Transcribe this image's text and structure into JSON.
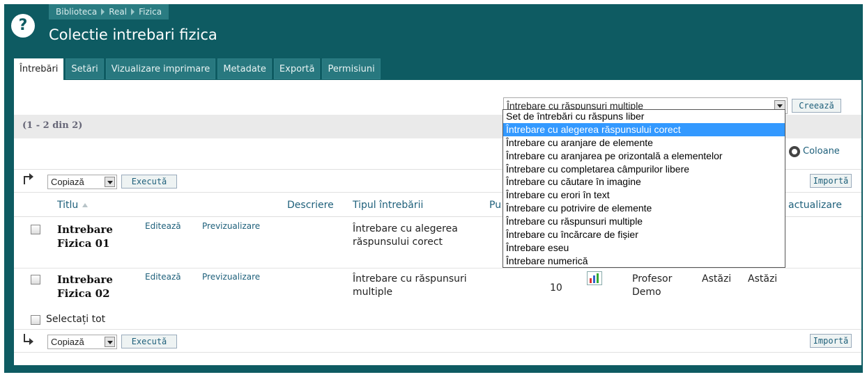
{
  "breadcrumbs": [
    "Biblioteca",
    "Real",
    "Fizica"
  ],
  "page_title": "Colectie intrebari fizica",
  "tabs": [
    "Întrebări",
    "Setări",
    "Vizualizare imprimare",
    "Metadate",
    "Exportă",
    "Permisiuni"
  ],
  "active_tab": "Întrebări",
  "question_type_select": {
    "value": "Întrebare cu răspunsuri multiple",
    "options": [
      "Set de întrebări cu răspuns liber",
      "Întrebare cu alegerea răspunsului corect",
      "Întrebare cu aranjare de elemente",
      "Întrebare cu aranjarea pe orizontală a elementelor",
      "Întrebare cu completarea câmpurilor libere",
      "Întrebare cu căutare în imagine",
      "Întrebare cu erori în text",
      "Întrebare cu potrivire de elemente",
      "Întrebare cu răspunsuri multiple",
      "Întrebare cu încărcare de fișier",
      "Întrebare eseu",
      "Întrebare numerică"
    ],
    "highlighted": "Întrebare cu alegerea răspunsului corect"
  },
  "create_label": "Creează",
  "count_text": "(1 - 2 din 2)",
  "columns_label": "Coloane",
  "action_select": "Copiază",
  "execute_label": "Execută",
  "import_label": "Importă",
  "table": {
    "headers": {
      "title": "Titlu",
      "description": "Descriere",
      "type": "Tipul întrebării",
      "points_partial": "Pu",
      "last_update_partial": "actualizare"
    },
    "rows": [
      {
        "title": "Intrebare Fizica 01",
        "edit": "Editează",
        "preview": "Previzualizare",
        "type": "Întrebare cu alegerea răspunsului corect"
      },
      {
        "title": "Intrebare Fizica 02",
        "edit": "Editează",
        "preview": "Previzualizare",
        "type": "Întrebare cu răspunsuri multiple",
        "points": "10",
        "author": "Profesor Demo",
        "created": "Astăzi",
        "updated": "Astăzi"
      }
    ]
  },
  "select_all": "Selectați tot",
  "colors": {
    "header_bg": "#0e5b62",
    "link": "#1d5f7a",
    "highlight": "#3399ff"
  }
}
